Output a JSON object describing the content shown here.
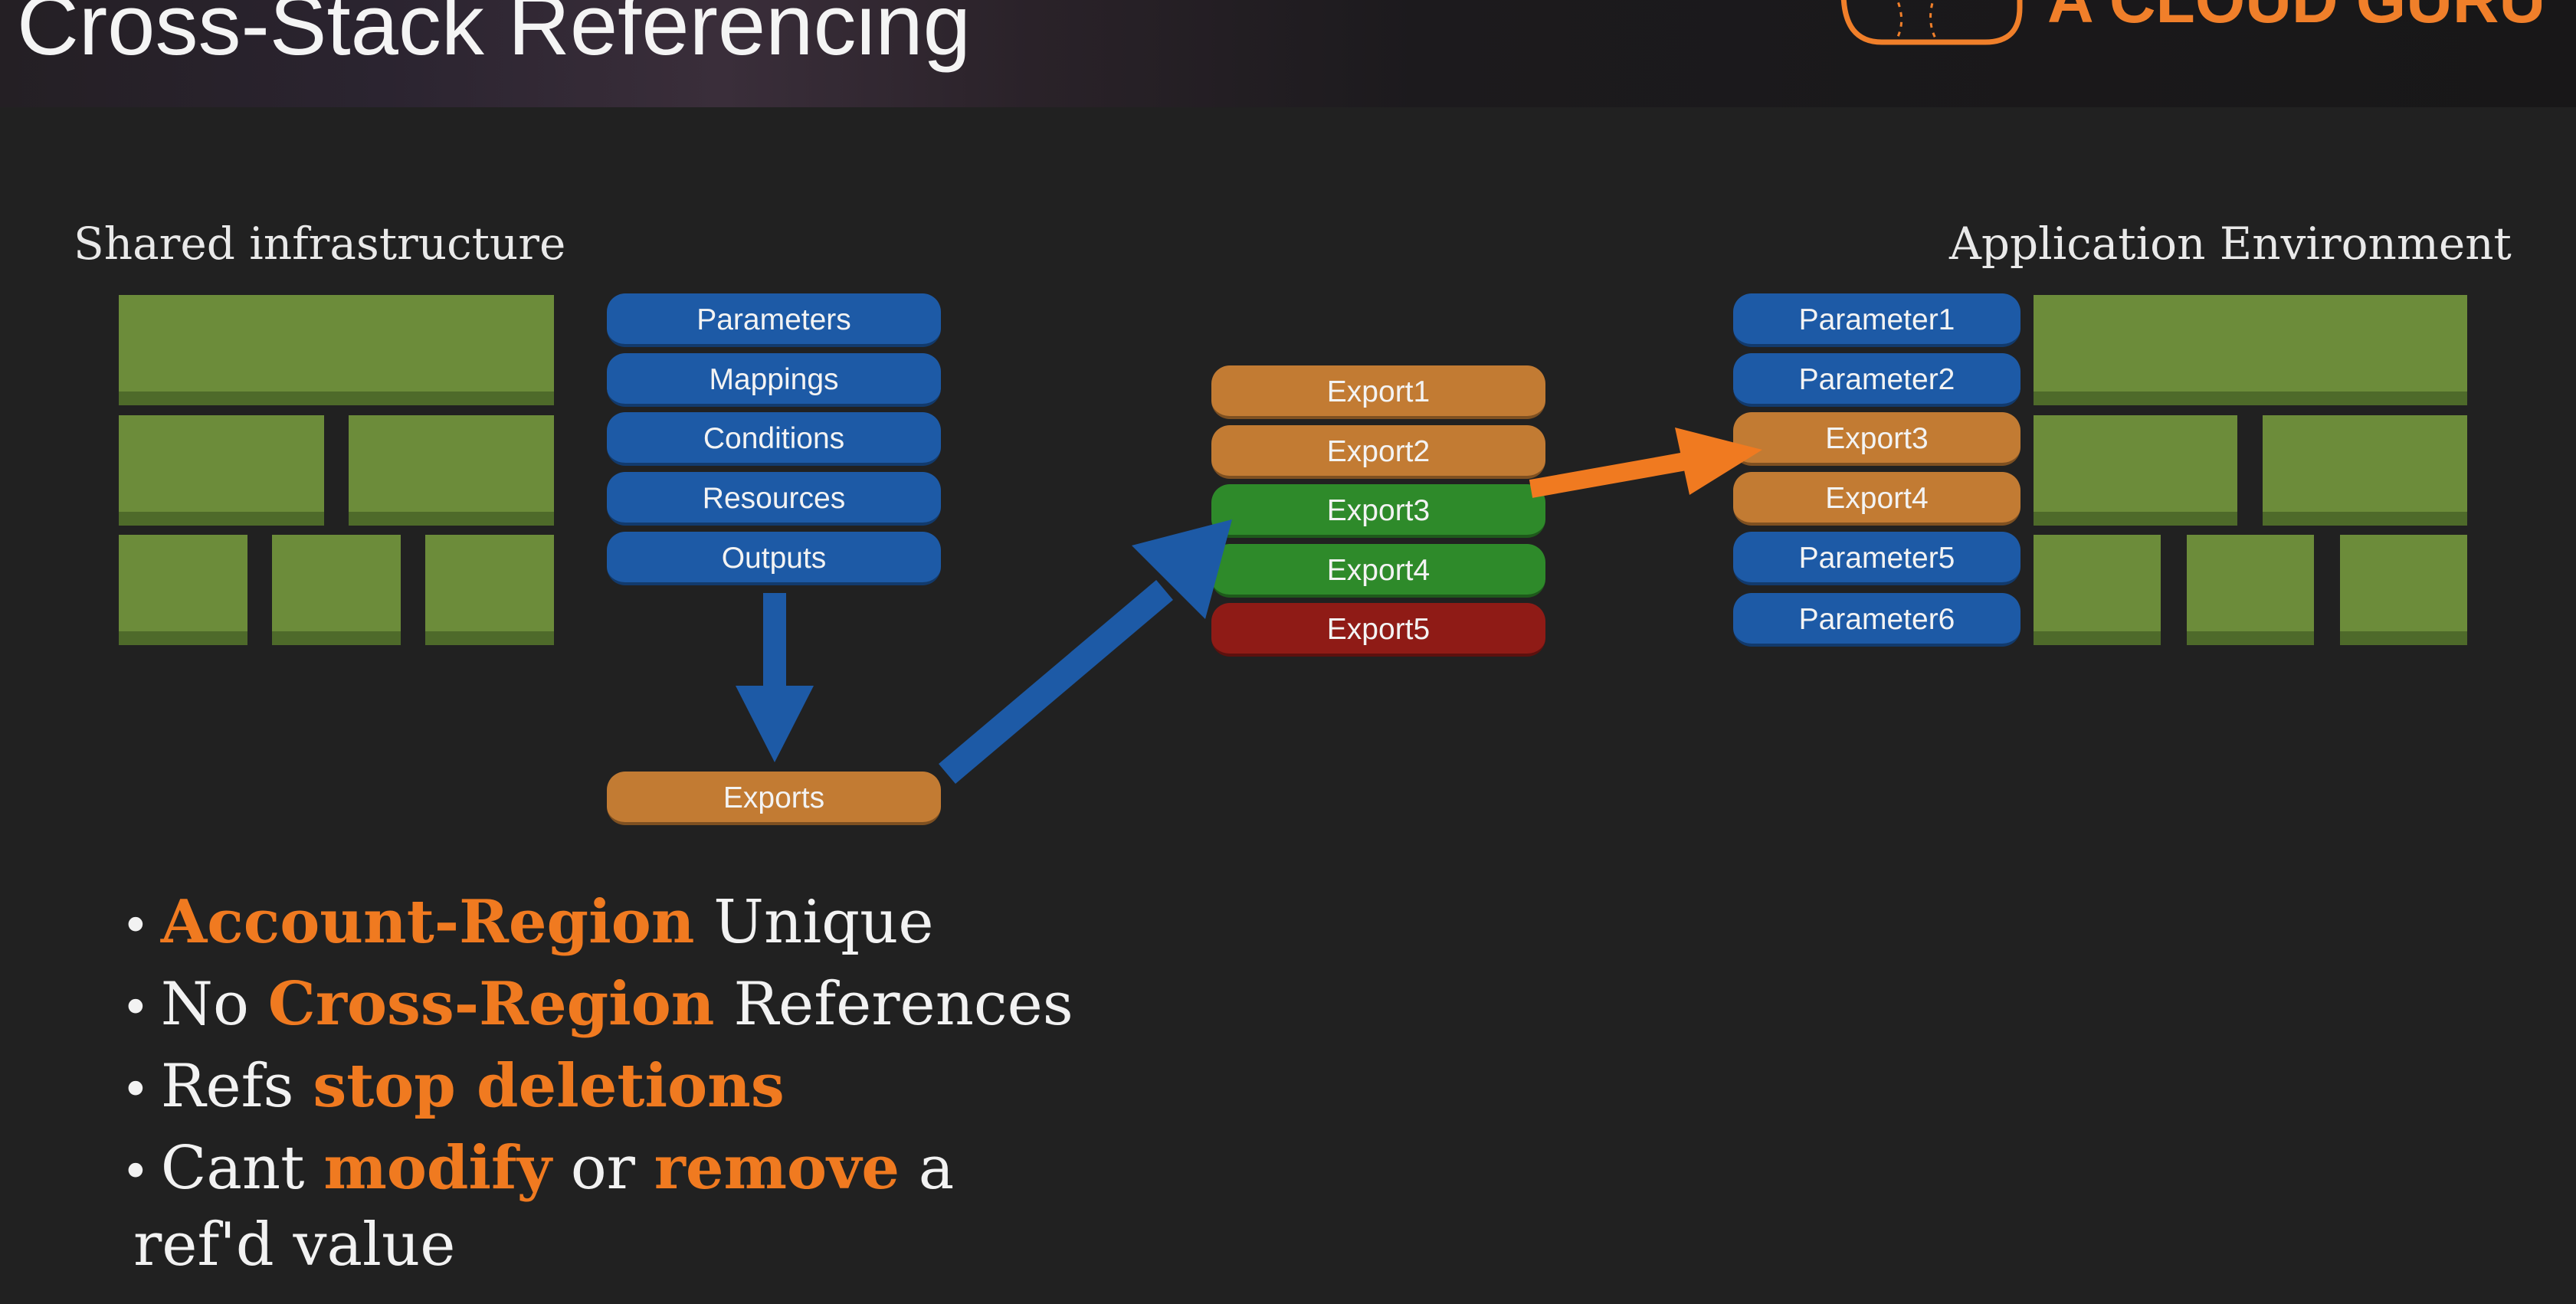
{
  "header": {
    "title": "Cross-Stack Referencing",
    "brand": "A CLOUD GURU"
  },
  "labels": {
    "shared": "Shared infrastructure",
    "app": "Application Environment"
  },
  "template_sections": [
    "Parameters",
    "Mappings",
    "Conditions",
    "Resources",
    "Outputs"
  ],
  "exports_label": "Exports",
  "exports_list": [
    "Export1",
    "Export2",
    "Export3",
    "Export4",
    "Export5"
  ],
  "app_params": [
    "Parameter1",
    "Parameter2",
    "Export3",
    "Export4",
    "Parameter5",
    "Parameter6"
  ],
  "bullets": [
    {
      "lead": "",
      "hl": "Account-Region",
      "mid": " Unique",
      "hl2": "",
      "tail": ""
    },
    {
      "lead": "No ",
      "hl": "Cross-Region",
      "mid": " References",
      "hl2": "",
      "tail": ""
    },
    {
      "lead": "Refs ",
      "hl": "stop deletions",
      "mid": "",
      "hl2": "",
      "tail": ""
    },
    {
      "lead": "Cant ",
      "hl": "modify",
      "mid": " or ",
      "hl2": "remove",
      "tail": " a"
    }
  ],
  "bullet_continuation": "ref'd value",
  "colors": {
    "accent": "#f07a20",
    "blue": "#1d5aa6",
    "orange": "#c27b33",
    "green": "#2e8a2a",
    "red": "#8f1b16",
    "block_green": "#6c8c3a",
    "background": "#212121"
  }
}
